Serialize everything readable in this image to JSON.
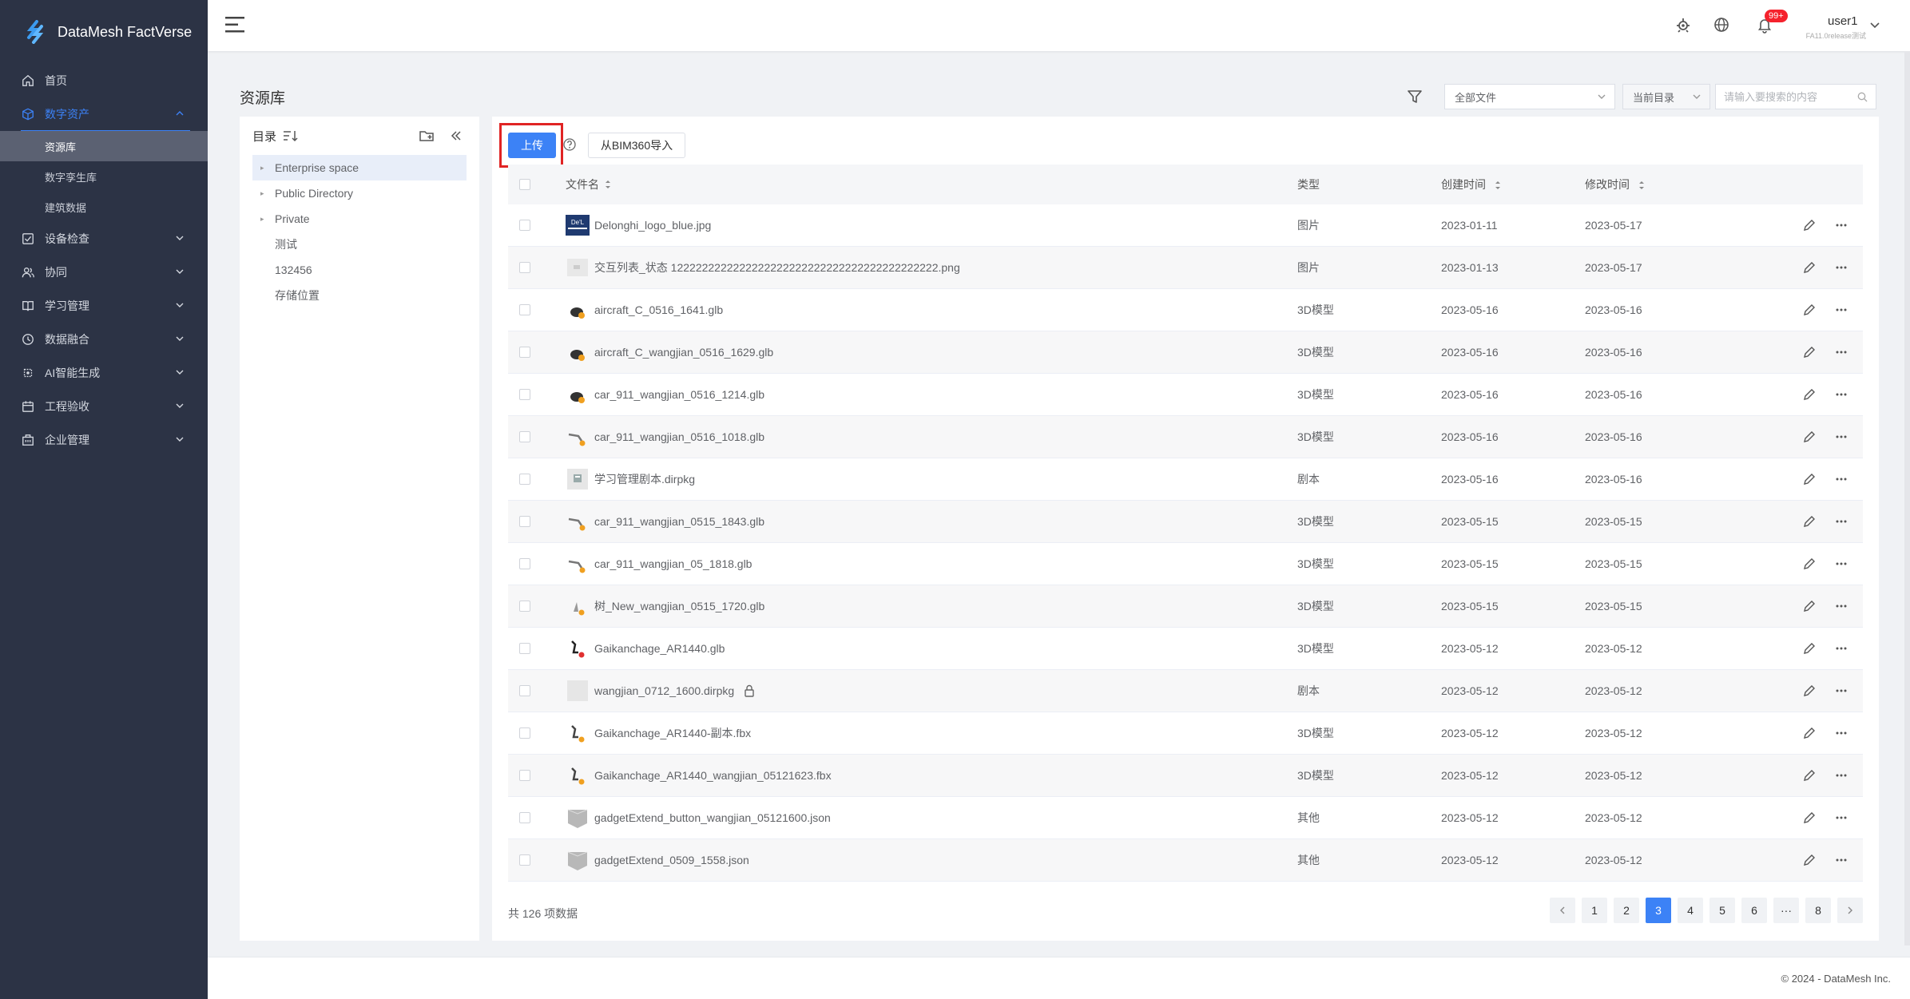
{
  "app": {
    "brand": "DataMesh FactVerse"
  },
  "sidebar": {
    "items": [
      {
        "label": "首页",
        "icon": "home-icon"
      },
      {
        "label": "数字资产",
        "icon": "cube-icon",
        "expanded": true,
        "children": [
          {
            "label": "资源库",
            "selected": true
          },
          {
            "label": "数字孪生库"
          },
          {
            "label": "建筑数据"
          }
        ]
      },
      {
        "label": "设备检查",
        "icon": "checklist-icon"
      },
      {
        "label": "协同",
        "icon": "users-icon"
      },
      {
        "label": "学习管理",
        "icon": "book-icon"
      },
      {
        "label": "数据融合",
        "icon": "data-fusion-icon"
      },
      {
        "label": "AI智能生成",
        "icon": "ai-icon"
      },
      {
        "label": "工程验收",
        "icon": "calendar-icon"
      },
      {
        "label": "企业管理",
        "icon": "building-icon"
      }
    ]
  },
  "header": {
    "notification_badge": "99+",
    "user_name": "user1",
    "user_sub": "FA11.0release测试"
  },
  "page": {
    "title": "资源库",
    "file_filter": "全部文件",
    "scope_filter": "当前目录",
    "search_placeholder": "请输入要搜索的内容"
  },
  "tree": {
    "title": "目录",
    "nodes": [
      {
        "label": "Enterprise space",
        "expandable": true,
        "selected": true
      },
      {
        "label": "Public Directory",
        "expandable": true
      },
      {
        "label": "Private",
        "expandable": true
      },
      {
        "label": "测试"
      },
      {
        "label": "132456"
      },
      {
        "label": "存储位置"
      }
    ]
  },
  "toolbar": {
    "upload_label": "上传",
    "bim_label": "从BIM360导入"
  },
  "table": {
    "columns": {
      "name": "文件名",
      "type": "类型",
      "created": "创建时间",
      "modified": "修改时间"
    },
    "rows": [
      {
        "name": "Delonghi_logo_blue.jpg",
        "type": "图片",
        "created": "2023-01-11",
        "modified": "2023-05-17",
        "thumb": "logo-thumb-icon"
      },
      {
        "name": "交互列表_状态 1222222222222222222222222222222222222222222.png",
        "type": "图片",
        "created": "2023-01-13",
        "modified": "2023-05-17",
        "thumb": "image-placeholder-icon"
      },
      {
        "name": "aircraft_C_0516_1641.glb",
        "type": "3D模型",
        "created": "2023-05-16",
        "modified": "2023-05-16",
        "thumb": "model-dark-icon"
      },
      {
        "name": "aircraft_C_wangjian_0516_1629.glb",
        "type": "3D模型",
        "created": "2023-05-16",
        "modified": "2023-05-16",
        "thumb": "model-dark-icon"
      },
      {
        "name": "car_911_wangjian_0516_1214.glb",
        "type": "3D模型",
        "created": "2023-05-16",
        "modified": "2023-05-16",
        "thumb": "model-dark-icon"
      },
      {
        "name": "car_911_wangjian_0516_1018.glb",
        "type": "3D模型",
        "created": "2023-05-16",
        "modified": "2023-05-16",
        "thumb": "model-car-icon"
      },
      {
        "name": "学习管理剧本.dirpkg",
        "type": "剧本",
        "created": "2023-05-16",
        "modified": "2023-05-16",
        "thumb": "script-package-icon"
      },
      {
        "name": "car_911_wangjian_0515_1843.glb",
        "type": "3D模型",
        "created": "2023-05-15",
        "modified": "2023-05-15",
        "thumb": "model-car-icon"
      },
      {
        "name": "car_911_wangjian_05_1818.glb",
        "type": "3D模型",
        "created": "2023-05-15",
        "modified": "2023-05-15",
        "thumb": "model-car-icon"
      },
      {
        "name": "树_New_wangjian_0515_1720.glb",
        "type": "3D模型",
        "created": "2023-05-15",
        "modified": "2023-05-15",
        "thumb": "model-tree-icon"
      },
      {
        "name": "Gaikanchage_AR1440.glb",
        "type": "3D模型",
        "created": "2023-05-12",
        "modified": "2023-05-12",
        "thumb": "model-robot-red-icon"
      },
      {
        "name": "wangjian_0712_1600.dirpkg",
        "type": "剧本",
        "created": "2023-05-12",
        "modified": "2023-05-12",
        "thumb": "script-blank-icon",
        "locked": true
      },
      {
        "name": "Gaikanchage_AR1440-副本.fbx",
        "type": "3D模型",
        "created": "2023-05-12",
        "modified": "2023-05-12",
        "thumb": "model-robot-icon"
      },
      {
        "name": "Gaikanchage_AR1440_wangjian_05121623.fbx",
        "type": "3D模型",
        "created": "2023-05-12",
        "modified": "2023-05-12",
        "thumb": "model-robot-icon"
      },
      {
        "name": "gadgetExtend_button_wangjian_05121600.json",
        "type": "其他",
        "created": "2023-05-12",
        "modified": "2023-05-12",
        "thumb": "file-generic-icon"
      },
      {
        "name": "gadgetExtend_0509_1558.json",
        "type": "其他",
        "created": "2023-05-12",
        "modified": "2023-05-12",
        "thumb": "file-generic-icon"
      }
    ]
  },
  "pagination": {
    "total": "共 126 项数据",
    "pages": [
      "1",
      "2",
      "3",
      "4",
      "5",
      "6",
      "···",
      "8"
    ],
    "current": "3"
  },
  "footer": {
    "copyright": "© 2024 - DataMesh Inc."
  },
  "colors": {
    "accent": "#3c82f6",
    "sidebar_bg": "#2c3345",
    "highlight_red": "#e02424",
    "badge_red": "#f5222d"
  }
}
